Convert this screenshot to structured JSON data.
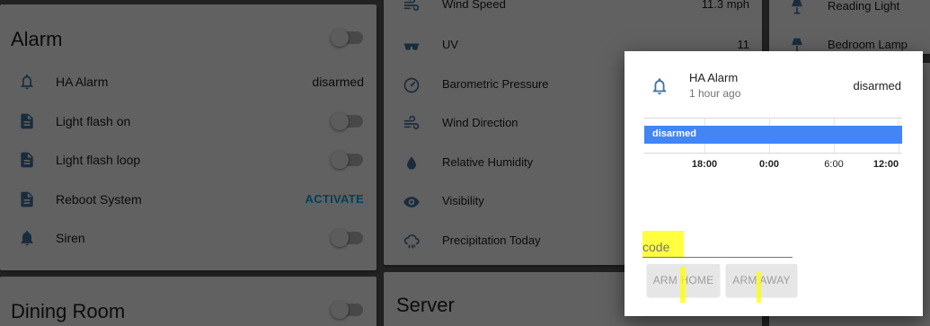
{
  "alarm_card": {
    "title": "Alarm",
    "rows": [
      {
        "label": "HA Alarm",
        "state": "disarmed",
        "icon": "bell-outline-icon"
      },
      {
        "label": "Light flash on",
        "icon": "script-file-icon"
      },
      {
        "label": "Light flash loop",
        "icon": "script-file-icon"
      },
      {
        "label": "Reboot System",
        "action": "ACTIVATE",
        "icon": "script-file-icon"
      },
      {
        "label": "Siren",
        "icon": "bell-icon"
      }
    ]
  },
  "dining_card": {
    "title": "Dining Room"
  },
  "weather_card": {
    "rows": [
      {
        "label": "Wind Speed",
        "value": "11.3 mph",
        "icon": "wind-icon"
      },
      {
        "label": "UV",
        "value": "11",
        "icon": "sunglasses-icon"
      },
      {
        "label": "Barometric Pressure",
        "value": "",
        "icon": "gauge-icon"
      },
      {
        "label": "Wind Direction",
        "value": "",
        "icon": "wind-icon"
      },
      {
        "label": "Relative Humidity",
        "value": "",
        "icon": "water-percent-icon"
      },
      {
        "label": "Visibility",
        "value": "",
        "icon": "eye-icon"
      },
      {
        "label": "Precipitation Today",
        "value": "",
        "icon": "weather-pouring-icon"
      }
    ]
  },
  "server_card": {
    "title": "Server"
  },
  "lights_card": {
    "rows": [
      {
        "label": "Reading Light",
        "icon": "lamp-icon"
      },
      {
        "label": "Bedroom Lamp",
        "icon": "lamp-icon"
      }
    ]
  },
  "dialog": {
    "entity_name": "HA Alarm",
    "last_changed": "1 hour ago",
    "state": "disarmed",
    "timeline": {
      "bar_label": "disarmed",
      "bar_color": "#4285f4",
      "ticks": [
        {
          "label": "18:00",
          "bold": true
        },
        {
          "label": "0:00",
          "bold": true
        },
        {
          "label": "6:00",
          "bold": false
        },
        {
          "label": "12:00",
          "bold": true
        }
      ]
    },
    "code_placeholder": "code",
    "arm_home_label": "ARM HOME",
    "arm_away_label": "ARM AWAY"
  },
  "colors": {
    "accent": "#03a9f4",
    "icon": "#44739e",
    "highlight": "#ffff00"
  }
}
